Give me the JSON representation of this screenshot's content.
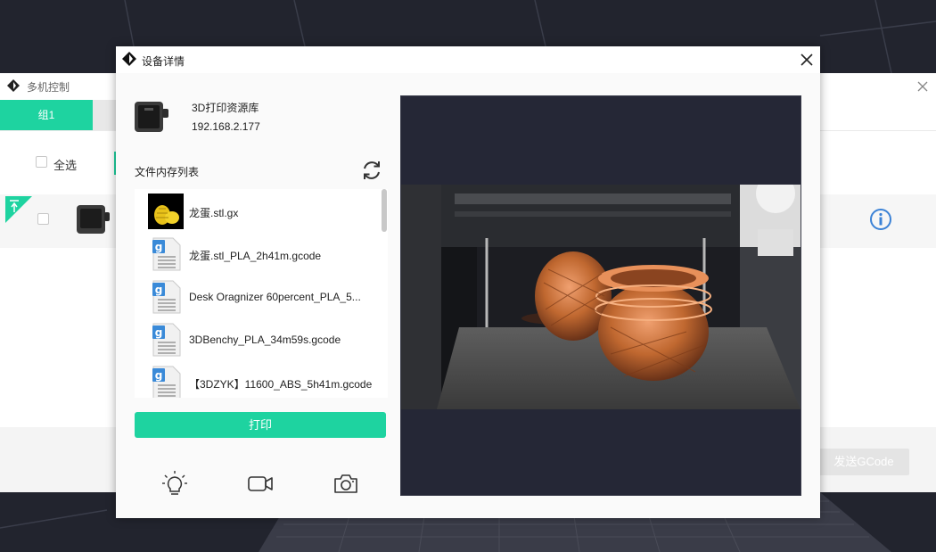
{
  "background_window": {
    "title": "多机控制",
    "group_tab_label": "组1",
    "select_all_label": "全选",
    "send_gcode_label": "发送GCode"
  },
  "dialog": {
    "title": "设备详情",
    "device": {
      "name": "3D打印资源库",
      "ip": "192.168.2.177"
    },
    "file_list_label": "文件内存列表",
    "files": [
      {
        "name": "龙蛋.stl.gx",
        "icon": "thumbnail-egg"
      },
      {
        "name": "龙蛋.stl_PLA_2h41m.gcode",
        "icon": "gcode-file-icon"
      },
      {
        "name": "Desk Oragnizer 60percent_PLA_5...",
        "icon": "gcode-file-icon"
      },
      {
        "name": "3DBenchy_PLA_34m59s.gcode",
        "icon": "gcode-file-icon"
      },
      {
        "name": "【3DZYK】11600_ABS_5h41m.gcode",
        "icon": "gcode-file-icon"
      }
    ],
    "print_button_label": "打印",
    "tools": [
      "light-bulb-icon",
      "video-camera-icon",
      "photo-camera-icon"
    ]
  },
  "colors": {
    "accent": "#1ed3a0",
    "info_blue": "#3b82d6",
    "camera_bg": "#252736"
  }
}
